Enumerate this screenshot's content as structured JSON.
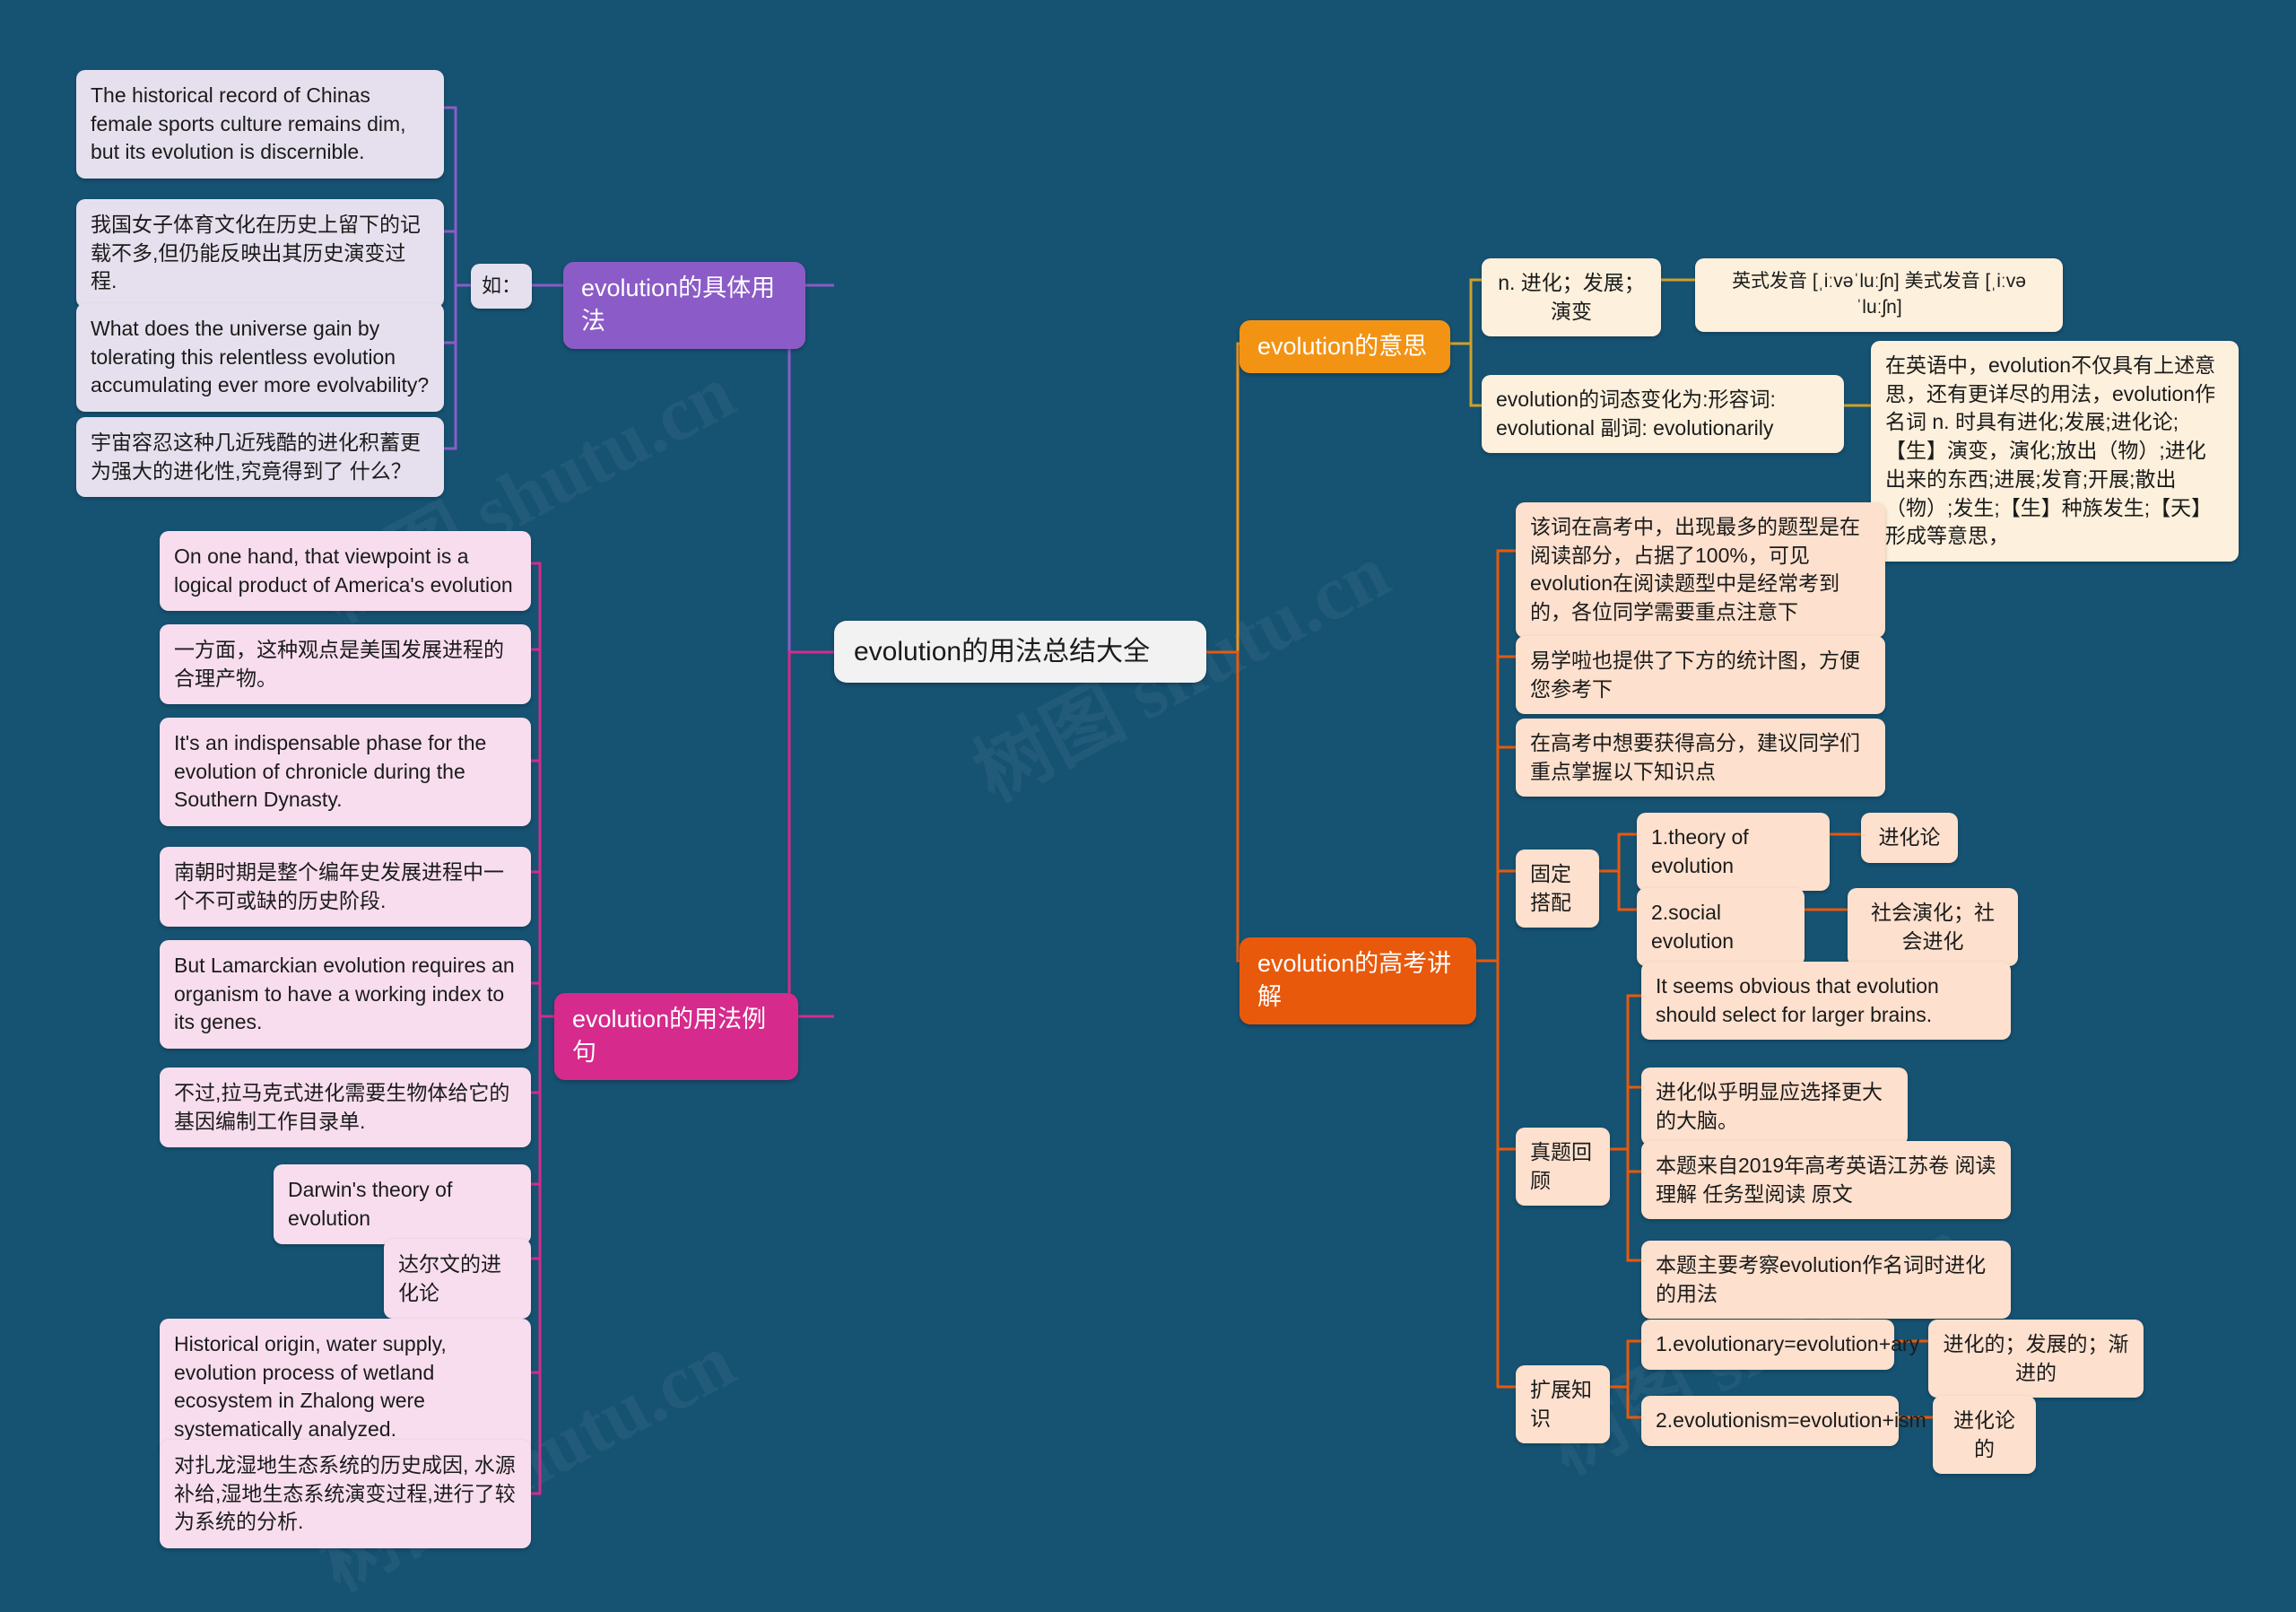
{
  "theme": {
    "background": "#165272",
    "root_fill": "#f2f2f2",
    "purple": "#8b5cc7",
    "magenta": "#d62a8c",
    "orange": "#f39314",
    "deep_orange": "#e8590c",
    "lavender_leaf": "#e6e0ee",
    "pink_leaf": "#f7ddee",
    "cream_leaf": "#fdf0dc",
    "peach_leaf": "#fde0cd"
  },
  "watermarks": [
    "树图 shutu.cn",
    "树图 shutu.cn",
    "树图 shutu.cn",
    "树图 shutu.cn"
  ],
  "root": {
    "label": "evolution的用法总结大全"
  },
  "left": {
    "usage_branch": {
      "label": "evolution的具体用法",
      "connector_label": "如：",
      "items": [
        {
          "text": "The historical record of Chinas female sports culture remains dim, but its evolution is discernible."
        },
        {
          "text": "我国女子体育文化在历史上留下的记载不多,但仍能反映出其历史演变过程."
        },
        {
          "text": "What does the universe gain by tolerating this relentless evolution accumulating ever more evolvability?"
        },
        {
          "text": "宇宙容忍这种几近残酷的进化积蓄更为强大的进化性,究竟得到了 什么？"
        }
      ]
    },
    "examples_branch": {
      "label": "evolution的用法例句",
      "items": [
        {
          "text": "On one hand, that viewpoint is a logical product of America's evolution"
        },
        {
          "text": "一方面，这种观点是美国发展进程的合理产物。"
        },
        {
          "text": "It's an indispensable phase for the evolution of chronicle during the Southern Dynasty."
        },
        {
          "text": "南朝时期是整个编年史发展进程中一个不可或缺的历史阶段."
        },
        {
          "text": "But Lamarckian evolution requires an organism to have a working index to its genes."
        },
        {
          "text": "不过,拉马克式进化需要生物体给它的基因编制工作目录单."
        },
        {
          "text": "Darwin's theory of evolution"
        },
        {
          "text": "达尔文的进化论"
        },
        {
          "text": "Historical origin, water supply, evolution process of wetland ecosystem in Zhalong were systematically analyzed."
        },
        {
          "text": "对扎龙湿地生态系统的历史成因, 水源补给,湿地生态系统演变过程,进行了较为系统的分析."
        }
      ]
    }
  },
  "right": {
    "meaning_branch": {
      "label": "evolution的意思",
      "definition": "n. 进化；发展；演变",
      "pronunciation": "英式发音 [ˌiːvəˈluːʃn] 美式发音 [ˌiːvəˈluːʃn]",
      "word_forms": "evolution的词态变化为:形容词: evolutional 副词: evolutionarily",
      "detail": "在英语中，evolution不仅具有上述意思，还有更详尽的用法，evolution作名词 n. 时具有进化;发展;进化论;【生】演变，演化;放出（物）;进化出来的东西;进展;发育;开展;散出（物）;发生;【生】种族发生;【天】形成等意思，"
    },
    "gaokao_branch": {
      "label": "evolution的高考讲解",
      "notes": [
        {
          "text": "该词在高考中，出现最多的题型是在阅读部分，占据了100%，可见evolution在阅读题型中是经常考到的，各位同学需要重点注意下"
        },
        {
          "text": "易学啦也提供了下方的统计图，方便您参考下"
        },
        {
          "text": "在高考中想要获得高分，建议同学们重点掌握以下知识点"
        }
      ],
      "collocations": {
        "label": "固定搭配",
        "rows": [
          {
            "phrase": "1.theory of evolution",
            "meaning": "进化论"
          },
          {
            "phrase": "2.social evolution",
            "meaning": "社会演化；社会进化"
          }
        ]
      },
      "past_papers": {
        "label": "真题回顾",
        "items": [
          {
            "text": "It seems obvious that evolution should select for larger brains."
          },
          {
            "text": "进化似乎明显应选择更大的大脑。"
          },
          {
            "text": "本题来自2019年高考英语江苏卷 阅读理解 任务型阅读 原文"
          },
          {
            "text": "本题主要考察evolution作名词时进化的用法"
          }
        ]
      },
      "extended": {
        "label": "扩展知识",
        "rows": [
          {
            "phrase": "1.evolutionary=evolution+ary",
            "meaning": "进化的；发展的；渐进的"
          },
          {
            "phrase": "2.evolutionism=evolution+ism",
            "meaning": "进化论的"
          }
        ]
      }
    }
  }
}
